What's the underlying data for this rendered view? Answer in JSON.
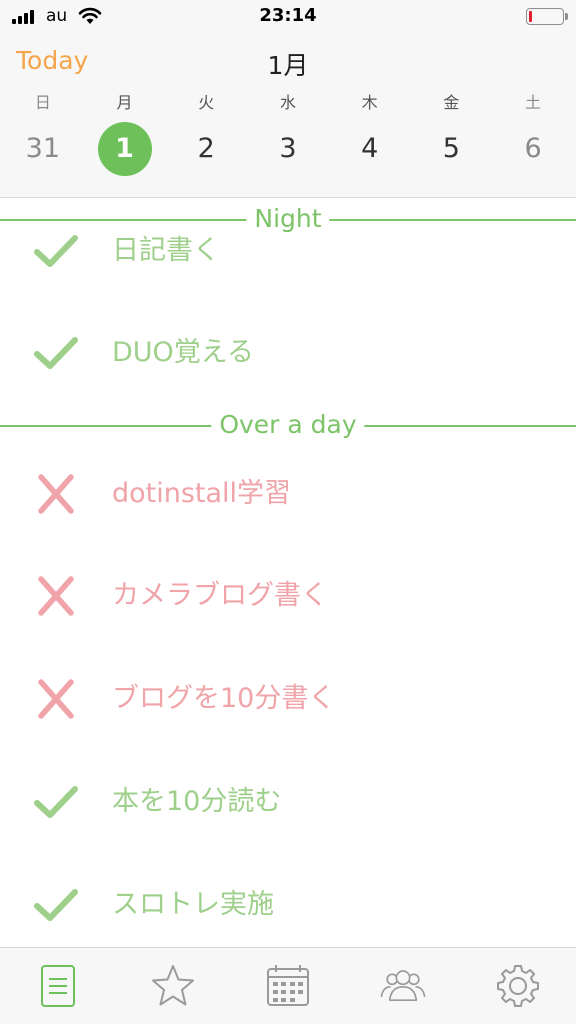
{
  "status_bar": {
    "carrier": "au",
    "time": "23:14",
    "battery_level": 0.1,
    "battery_color": "#e0202f"
  },
  "header": {
    "today_label": "Today",
    "month": "1月",
    "days": [
      {
        "name": "日",
        "num": "31"
      },
      {
        "name": "月",
        "num": "1"
      },
      {
        "name": "火",
        "num": "2"
      },
      {
        "name": "水",
        "num": "3"
      },
      {
        "name": "木",
        "num": "4"
      },
      {
        "name": "金",
        "num": "5"
      },
      {
        "name": "土",
        "num": "6"
      }
    ],
    "selected_day": "1"
  },
  "sections": [
    {
      "label": "Night",
      "tasks": [
        {
          "label": "日記書く",
          "status": "done"
        },
        {
          "label": "DUO覚える",
          "status": "done"
        }
      ]
    },
    {
      "label": "Over a day",
      "tasks": [
        {
          "label": "dotinstall学習",
          "status": "failed"
        },
        {
          "label": "カメラブログ書く",
          "status": "failed"
        },
        {
          "label": "ブログを10分書く",
          "status": "failed"
        },
        {
          "label": "本を10分読む",
          "status": "done"
        },
        {
          "label": "スロトレ実施",
          "status": "done"
        }
      ]
    }
  ],
  "tab_bar": {
    "tabs": [
      {
        "icon": "list-icon",
        "active": true
      },
      {
        "icon": "star-icon",
        "active": false
      },
      {
        "icon": "calendar-icon",
        "active": false
      },
      {
        "icon": "group-icon",
        "active": false
      },
      {
        "icon": "gear-icon",
        "active": false
      }
    ]
  },
  "colors": {
    "accent_orange": "#f5a54b",
    "accent_green": "#6ec15a",
    "done_green": "#9ed08b",
    "failed_red": "#f0a3a8",
    "inactive_gray": "#9a9a9a"
  }
}
